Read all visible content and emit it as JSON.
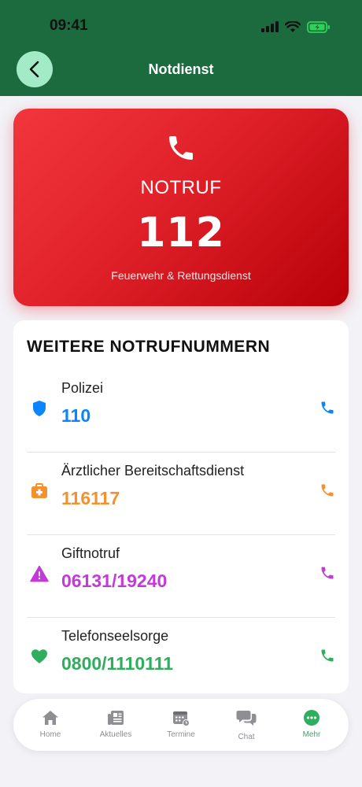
{
  "status_bar": {
    "time": "09:41"
  },
  "header": {
    "title": "Notdienst",
    "back_icon": "chevron-left-icon"
  },
  "colors": {
    "header_bg": "#1b6b3e",
    "back_bg": "#a3ebc7",
    "emergency_red": "#e0212a",
    "police": "#0a84ff",
    "medical": "#f5912c",
    "poison": "#c33ad8",
    "counseling": "#2fae5d",
    "tab_active": "#2fae5d"
  },
  "emergency": {
    "icon": "phone-icon",
    "label": "NOTRUF",
    "number": "112",
    "subtitle": "Feuerwehr & Rettungsdienst"
  },
  "more_numbers": {
    "heading": "WEITERE NOTRUFNUMMERN",
    "items": [
      {
        "name": "Polizei",
        "number": "110",
        "icon": "shield-icon",
        "color": "#0a84ff"
      },
      {
        "name": "Ärztlicher Bereitschaftsdienst",
        "number": "116117",
        "icon": "medical-kit-icon",
        "color": "#f5912c"
      },
      {
        "name": "Giftnotruf",
        "number": "06131/19240",
        "icon": "warning-icon",
        "color": "#c33ad8"
      },
      {
        "name": "Telefonseelsorge",
        "number": "0800/1110111",
        "icon": "heart-icon",
        "color": "#2fae5d"
      }
    ]
  },
  "tabbar": {
    "items": [
      {
        "label": "Home",
        "icon": "home-icon"
      },
      {
        "label": "Aktuelles",
        "icon": "newspaper-icon"
      },
      {
        "label": "Termine",
        "icon": "calendar-icon"
      },
      {
        "label": "Chat",
        "icon": "chat-icon"
      },
      {
        "label": "Mehr",
        "icon": "more-icon"
      }
    ],
    "active": "Mehr"
  }
}
